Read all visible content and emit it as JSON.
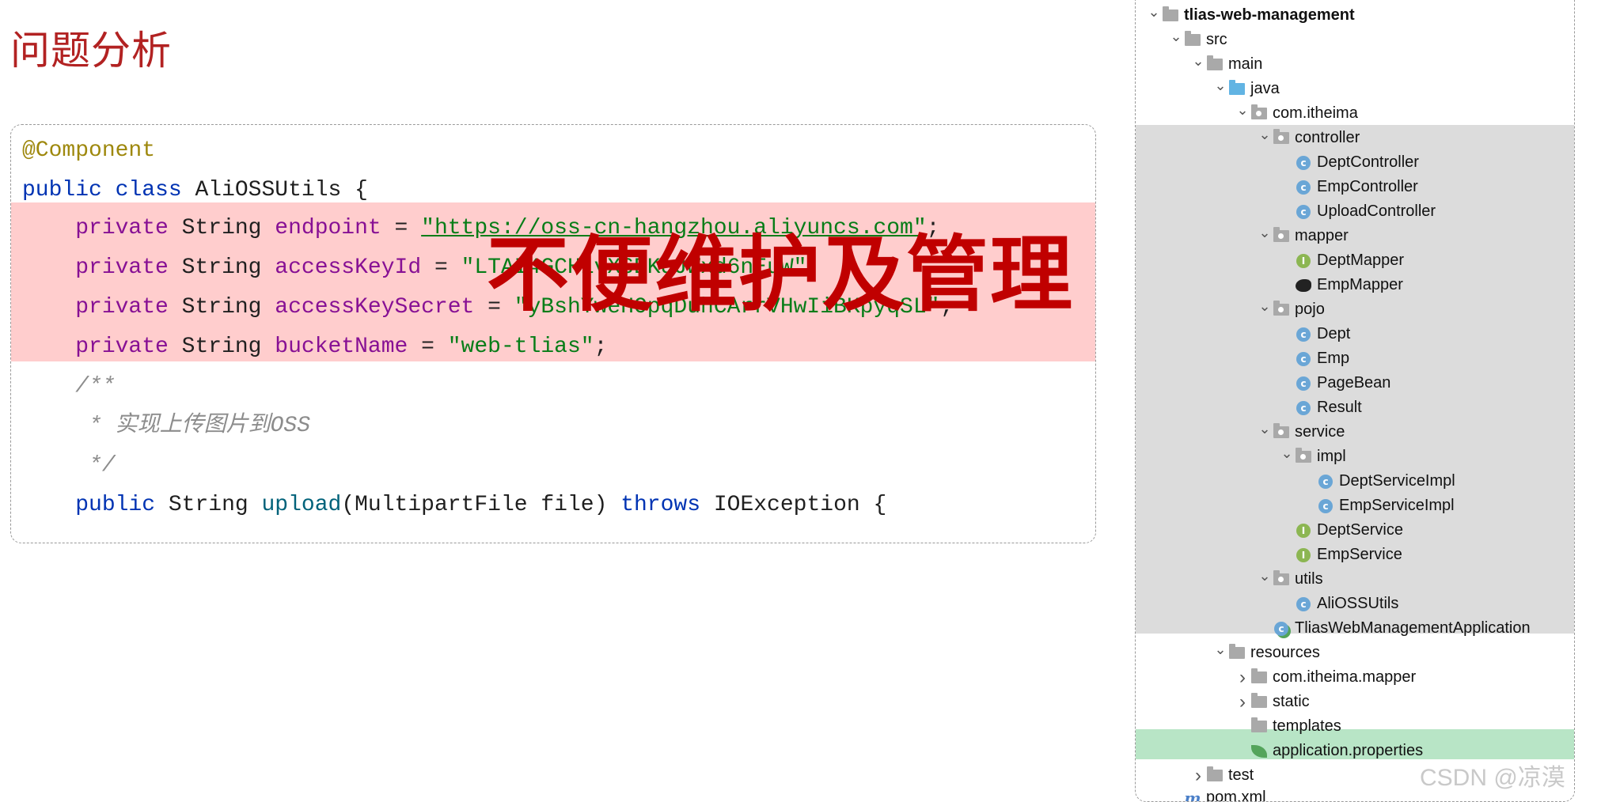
{
  "slide_title": "问题分析",
  "code": {
    "annotation": "@Component",
    "class_decl": {
      "kw1": "public",
      "kw2": "class",
      "name": "AliOSSUtils {"
    },
    "fields": [
      {
        "kw": "private",
        "type": "String",
        "name": "endpoint",
        "eq": " = ",
        "value": "\"https://oss-cn-hangzhou.aliyuncs.com\"",
        "end": ";"
      },
      {
        "kw": "private",
        "type": "String",
        "name": "accessKeyId",
        "eq": " = ",
        "value": "\"LTAI4GCH1vX6DKqJWxd6nEuW\"",
        "end": ";"
      },
      {
        "kw": "private",
        "type": "String",
        "name": "accessKeySecret",
        "eq": " = ",
        "value": "\"yBshYweHOpqDuhCArrVHwIiBKpyqSL\"",
        "end": ";"
      },
      {
        "kw": "private",
        "type": "String",
        "name": "bucketName",
        "eq": " = ",
        "value": "\"web-tlias\"",
        "end": ";"
      }
    ],
    "comment_lines": [
      "/**",
      " * 实现上传图片到OSS",
      " */"
    ],
    "method_decl": {
      "kw": "public",
      "type": "String",
      "name": "upload",
      "params": "(MultipartFile file)",
      "throws_kw": "throws",
      "rest": "IOException {"
    }
  },
  "overlay_text": "不便维护及管理",
  "tree": {
    "rows": [
      {
        "label": "tlias-web-management",
        "icon": "module-folder-icon",
        "chev": "open",
        "depth": 0,
        "bold": true
      },
      {
        "label": "src",
        "icon": "folder-icon",
        "chev": "open",
        "depth": 1
      },
      {
        "label": "main",
        "icon": "folder-icon",
        "chev": "open",
        "depth": 2
      },
      {
        "label": "java",
        "icon": "source-folder-icon",
        "chev": "open",
        "depth": 3
      },
      {
        "label": "com.itheima",
        "icon": "package-icon",
        "chev": "open",
        "depth": 4
      },
      {
        "label": "controller",
        "icon": "package-icon",
        "chev": "open",
        "depth": 5
      },
      {
        "label": "DeptController",
        "icon": "class-icon",
        "chev": "",
        "depth": 6
      },
      {
        "label": "EmpController",
        "icon": "class-icon",
        "chev": "",
        "depth": 6
      },
      {
        "label": "UploadController",
        "icon": "class-icon",
        "chev": "",
        "depth": 6
      },
      {
        "label": "mapper",
        "icon": "package-icon",
        "chev": "open",
        "depth": 5
      },
      {
        "label": "DeptMapper",
        "icon": "interface-icon",
        "chev": "",
        "depth": 6
      },
      {
        "label": "EmpMapper",
        "icon": "mybatis-bird-icon",
        "chev": "",
        "depth": 6
      },
      {
        "label": "pojo",
        "icon": "package-icon",
        "chev": "open",
        "depth": 5
      },
      {
        "label": "Dept",
        "icon": "class-icon",
        "chev": "",
        "depth": 6
      },
      {
        "label": "Emp",
        "icon": "class-icon",
        "chev": "",
        "depth": 6
      },
      {
        "label": "PageBean",
        "icon": "class-icon",
        "chev": "",
        "depth": 6
      },
      {
        "label": "Result",
        "icon": "class-icon",
        "chev": "",
        "depth": 6
      },
      {
        "label": "service",
        "icon": "package-icon",
        "chev": "open",
        "depth": 5
      },
      {
        "label": "impl",
        "icon": "package-icon",
        "chev": "open",
        "depth": 6
      },
      {
        "label": "DeptServiceImpl",
        "icon": "class-icon",
        "chev": "",
        "depth": 7
      },
      {
        "label": "EmpServiceImpl",
        "icon": "class-icon",
        "chev": "",
        "depth": 7
      },
      {
        "label": "DeptService",
        "icon": "interface-icon",
        "chev": "",
        "depth": 6
      },
      {
        "label": "EmpService",
        "icon": "interface-icon",
        "chev": "",
        "depth": 6
      },
      {
        "label": "utils",
        "icon": "package-icon",
        "chev": "open",
        "depth": 5
      },
      {
        "label": "AliOSSUtils",
        "icon": "class-icon",
        "chev": "",
        "depth": 6
      },
      {
        "label": "TliasWebManagementApplication",
        "icon": "spring-app-icon",
        "chev": "",
        "depth": 5
      },
      {
        "label": "resources",
        "icon": "resources-folder-icon",
        "chev": "open",
        "depth": 3
      },
      {
        "label": "com.itheima.mapper",
        "icon": "folder-icon",
        "chev": "closed",
        "depth": 4
      },
      {
        "label": "static",
        "icon": "folder-icon",
        "chev": "closed",
        "depth": 4
      },
      {
        "label": "templates",
        "icon": "folder-icon",
        "chev": "",
        "depth": 4
      },
      {
        "label": "application.properties",
        "icon": "spring-leaf-icon",
        "chev": "",
        "depth": 4
      },
      {
        "label": "test",
        "icon": "folder-icon",
        "chev": "closed",
        "depth": 2
      },
      {
        "label": "pom.xml",
        "icon": "maven-icon",
        "chev": "",
        "depth": 1
      }
    ]
  },
  "watermark": "CSDN @凉漠"
}
